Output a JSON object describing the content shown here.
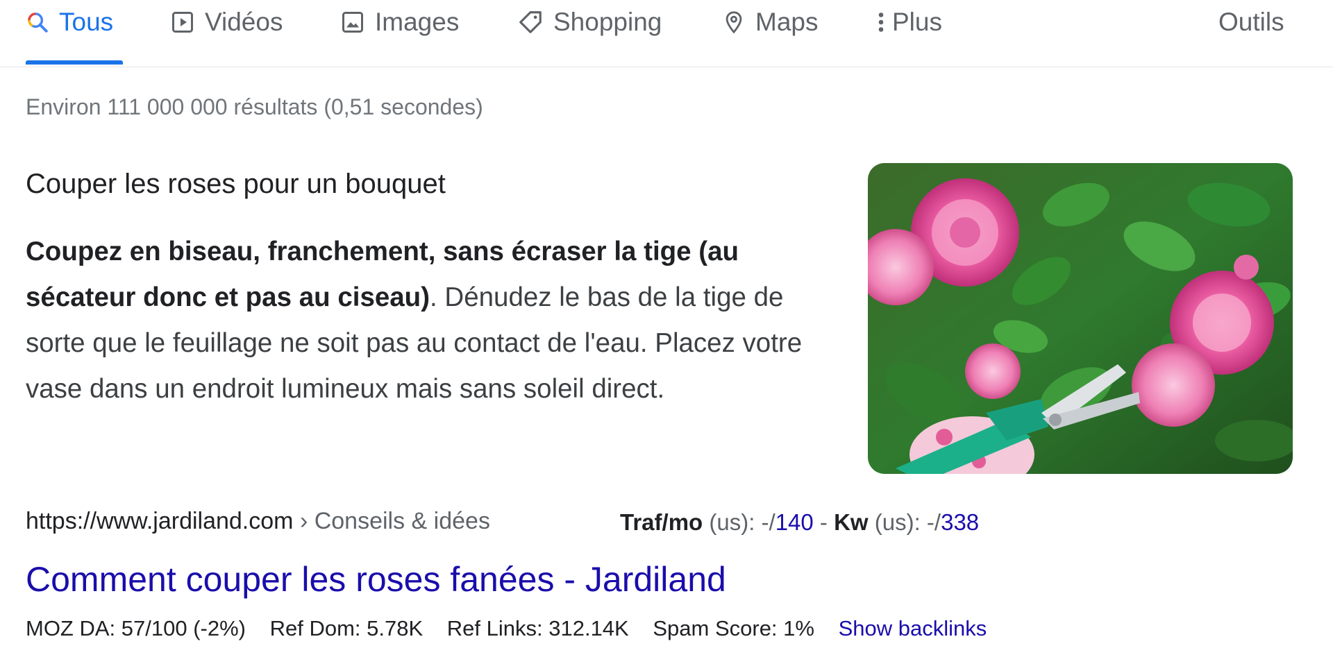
{
  "tabs": {
    "all": "Tous",
    "videos": "Vidéos",
    "images": "Images",
    "shopping": "Shopping",
    "maps": "Maps",
    "more": "Plus",
    "tools": "Outils"
  },
  "stats": "Environ 111 000 000 résultats (0,51 secondes)",
  "snippet": {
    "heading": "Couper les roses pour un bouquet",
    "bold_text": "Coupez en biseau, franchement, sans écraser la tige (au sécateur donc et pas au ciseau)",
    "rest_text": ". Dénudez le bas de la tige de sorte que le feuillage ne soit pas au contact de l'eau. Placez votre vase dans un endroit lumineux mais sans soleil direct."
  },
  "result": {
    "url": "https://www.jardiland.com",
    "breadcrumb": " › Conseils & idées",
    "title": "Comment couper les roses fanées - Jardiland"
  },
  "seo": {
    "traf_label": "Traf/mo",
    "traf_region": " (us): -/",
    "traf_value": "140",
    "separator": " - ",
    "kw_label": "Kw",
    "kw_region": " (us): -/",
    "kw_value": "338"
  },
  "metrics": {
    "moz_da": "MOZ DA: 57/100 (-2%)",
    "ref_dom": "Ref Dom: 5.78K",
    "ref_links": "Ref Links: 312.14K",
    "spam_score": "Spam Score: 1%",
    "show_backlinks": "Show backlinks"
  },
  "colors": {
    "accent": "#1a73e8",
    "link": "#1a0dab",
    "muted": "#70757a"
  }
}
